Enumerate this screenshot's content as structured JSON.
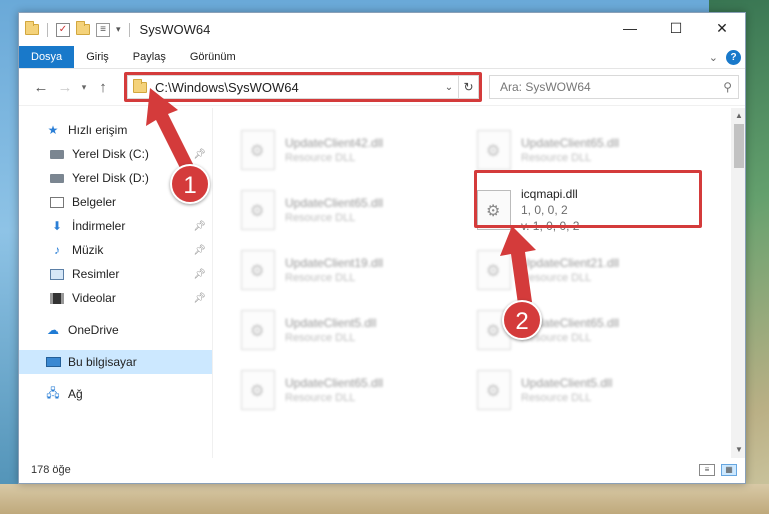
{
  "window": {
    "title": "SysWOW64",
    "controls": [
      "—",
      "☐",
      "✕"
    ]
  },
  "ribbon": {
    "tabs": [
      "Dosya",
      "Giriş",
      "Paylaş",
      "Görünüm"
    ]
  },
  "address": {
    "path": "C:\\Windows\\SysWOW64"
  },
  "search": {
    "placeholder": "Ara: SysWOW64"
  },
  "sidebar": {
    "items": [
      {
        "label": "Hızlı erişim"
      },
      {
        "label": "Yerel Disk (C:)"
      },
      {
        "label": "Yerel Disk (D:)"
      },
      {
        "label": "Belgeler"
      },
      {
        "label": "İndirmeler"
      },
      {
        "label": "Müzik"
      },
      {
        "label": "Resimler"
      },
      {
        "label": "Videolar"
      },
      {
        "label": "OneDrive"
      },
      {
        "label": "Bu bilgisayar"
      },
      {
        "label": "Ağ"
      }
    ]
  },
  "files": [
    {
      "name": "UpdateClient42.dll",
      "desc": "Resource DLL"
    },
    {
      "name": "UpdateClient65.dll",
      "desc": "Resource DLL"
    },
    {
      "name": "UpdateClient65.dll",
      "desc": "Resource DLL"
    },
    {
      "name": "UpdateClient19.dll",
      "desc": "Resource DLL"
    },
    {
      "name": "UpdateClient21.dll",
      "desc": "Resource DLL"
    },
    {
      "name": "UpdateClient5.dll",
      "desc": "Resource DLL"
    },
    {
      "name": "UpdateClient65.dll",
      "desc": "Resource DLL"
    },
    {
      "name": "UpdateClient65.dll",
      "desc": "Resource DLL"
    },
    {
      "name": "UpdateClient5.dll",
      "desc": "Resource DLL"
    }
  ],
  "highlighted_file": {
    "name": "icqmapi.dll",
    "line1": "1, 0, 0, 2",
    "line2": "v. 1, 0, 0, 2"
  },
  "status": {
    "count": "178 öğe"
  },
  "annotations": {
    "badge1": "1",
    "badge2": "2",
    "accent": "#d43b3b"
  }
}
